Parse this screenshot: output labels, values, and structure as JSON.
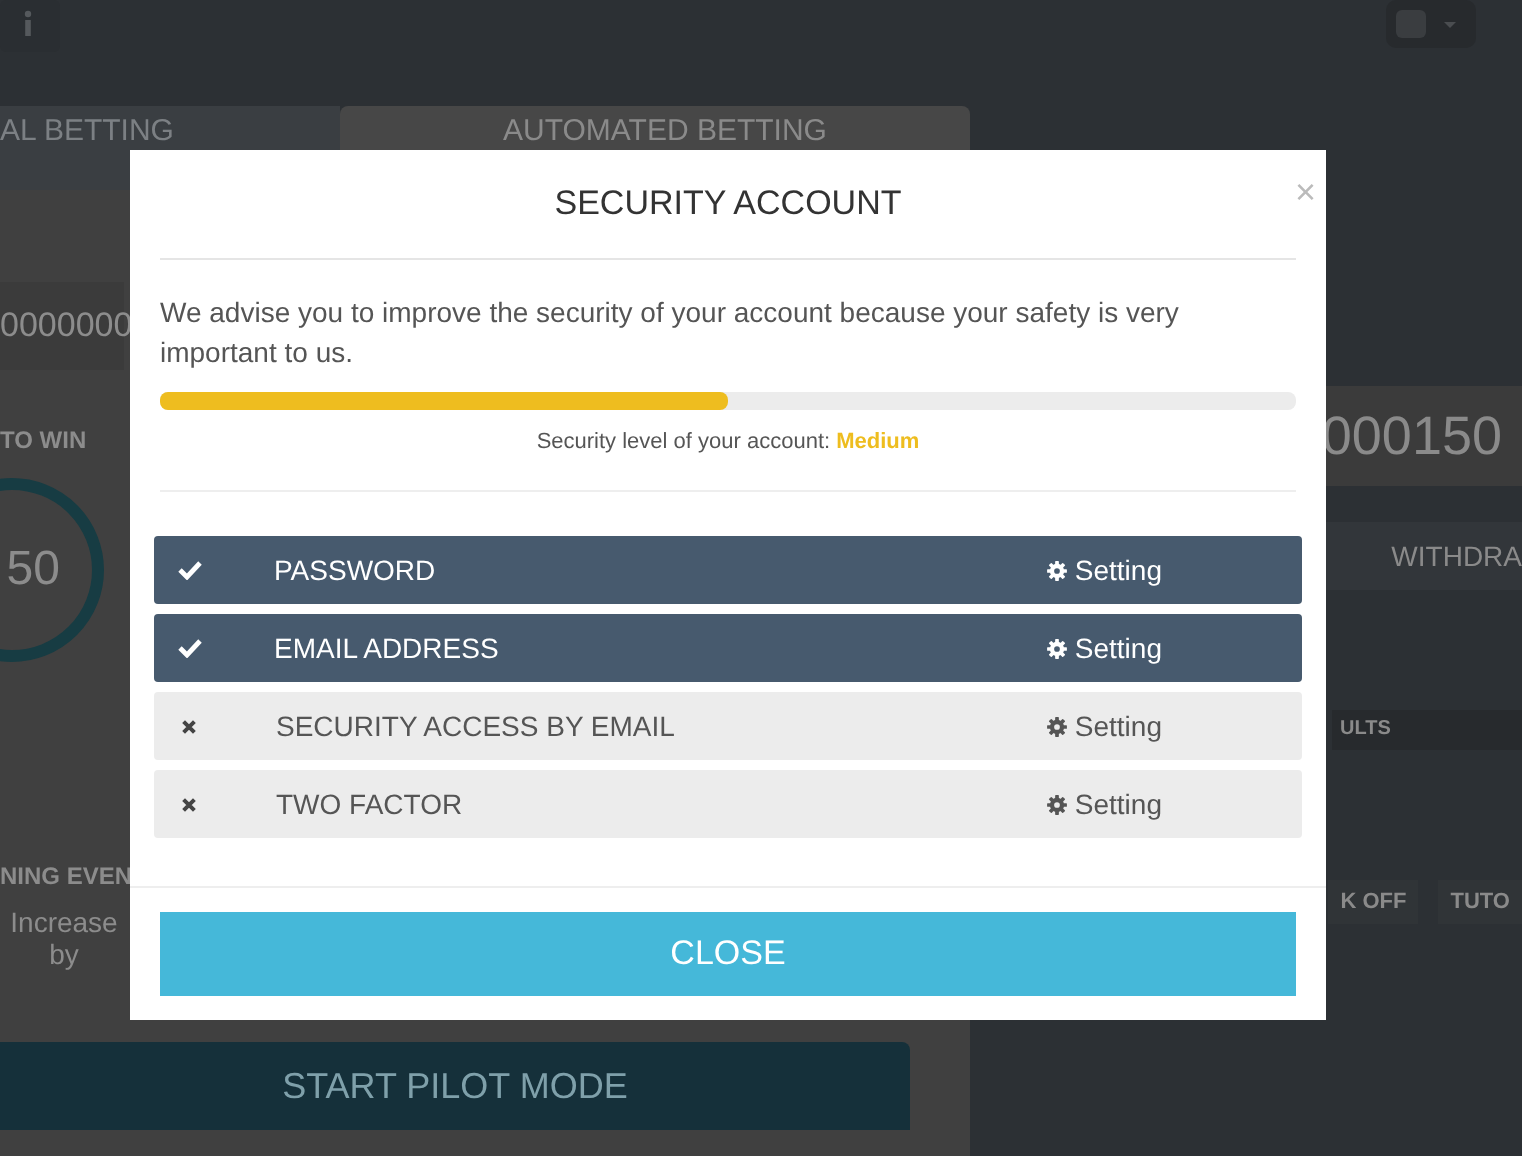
{
  "background": {
    "tabs": [
      {
        "label": "AL BETTING",
        "selected": false
      },
      {
        "label": "AUTOMATED BETTING",
        "selected": true
      }
    ],
    "balance_fragment": "0000000",
    "to_win_label": "TO WIN",
    "dial_value": "50",
    "event_label": "NING EVEN",
    "increase_label": "Increase by",
    "start_button": "START PILOT MODE",
    "right_amount": "000150",
    "withdraw_tab": "WITHDRA",
    "results_header": "ULTS",
    "buttons": [
      "K OFF",
      "TUTO"
    ]
  },
  "modal": {
    "title": "SECURITY ACCOUNT",
    "close_glyph": "×",
    "message": "We advise you to improve the security of your account because your safety is very important to us.",
    "security": {
      "level": 0.5,
      "caption": "Security level of your account: **Medium**"
    },
    "items": [
      {
        "label": "PASSWORD",
        "checked": true,
        "action": "Setting"
      },
      {
        "label": "EMAIL ADDRESS",
        "checked": true,
        "action": "Setting"
      },
      {
        "label": "SECURITY ACCESS BY EMAIL",
        "checked": false,
        "action": "Setting"
      },
      {
        "label": "TWO FACTOR",
        "checked": false,
        "action": "Setting"
      }
    ],
    "close_button": "CLOSE"
  }
}
